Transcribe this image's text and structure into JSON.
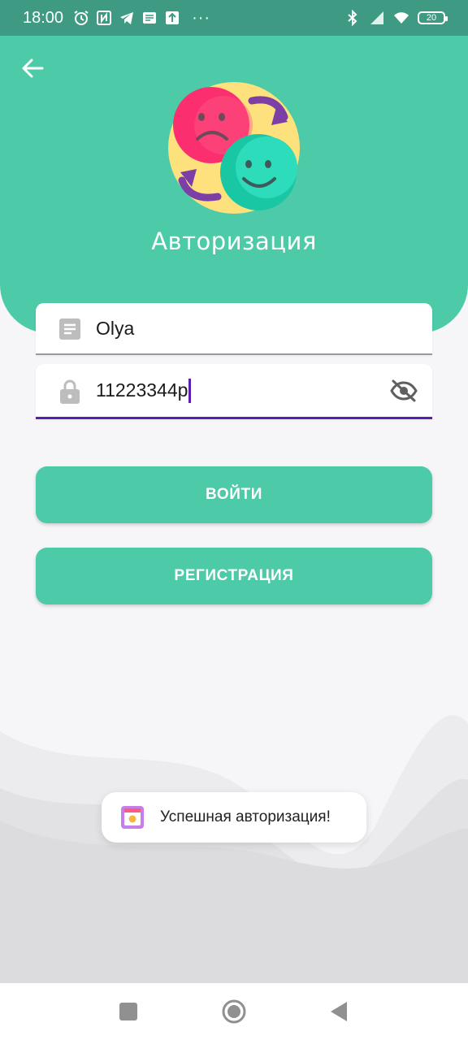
{
  "status_bar": {
    "time": "18:00",
    "more": "···",
    "battery": "20"
  },
  "header": {
    "title": "Авторизация"
  },
  "form": {
    "username_value": "Olya",
    "password_value": "11223344p"
  },
  "buttons": {
    "login_label": "ВОЙТИ",
    "register_label": "РЕГИСТРАЦИЯ"
  },
  "toast": {
    "message": "Успешная авторизация!"
  },
  "colors": {
    "accent": "#4dcaa8",
    "status_bar": "#3f9a83",
    "focus_underline": "#5b1fb0"
  },
  "icons": [
    "back-arrow-icon",
    "mood-swap-logo",
    "document-icon",
    "lock-icon",
    "eye-off-icon",
    "app-icon",
    "square-icon",
    "circle-home-icon",
    "triangle-back-icon"
  ]
}
